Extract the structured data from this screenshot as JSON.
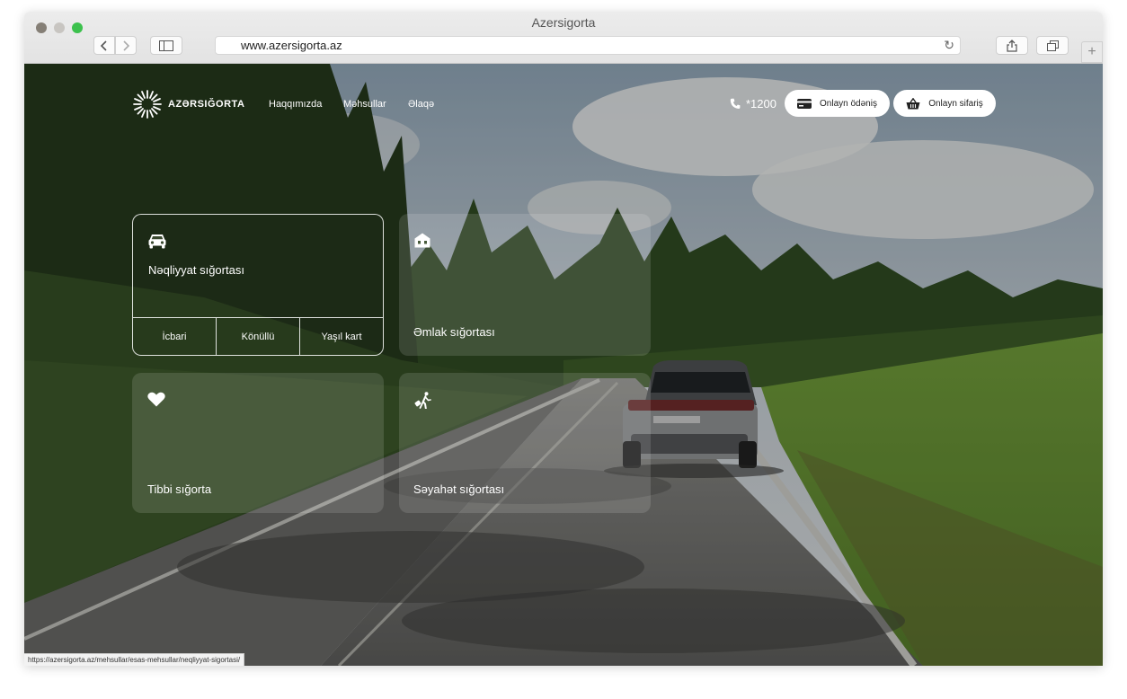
{
  "browser": {
    "window_title": "Azersigorta",
    "url": "www.azersigorta.az",
    "status_link": "https://azersigorta.az/mehsullar/esas-mehsullar/neqliyyat-sigortasi/"
  },
  "header": {
    "logo_text": "AZƏRSIĞORTA",
    "nav": {
      "about": "Haqqımızda",
      "products": "Məhsullar",
      "contact": "Əlaqə"
    },
    "phone": "*1200",
    "online_payment": "Onlayn ödəniş",
    "online_order": "Onlayn sifariş"
  },
  "cards": {
    "transport": {
      "title": "Nəqliyyat sığortası",
      "options": [
        "İcbari",
        "Könüllü",
        "Yaşıl kart"
      ]
    },
    "property": {
      "title": "Əmlak sığortası"
    },
    "medical": {
      "title": "Tibbi sığorta"
    },
    "travel": {
      "title": "Səyahət sığortası"
    }
  },
  "icons": {
    "transport": "car-icon",
    "property": "house-icon",
    "medical": "heart-icon",
    "travel": "traveler-icon",
    "phone": "phone-icon",
    "payment": "card-icon",
    "order": "basket-icon"
  },
  "colors": {
    "chrome_bg": "#e6e6e6",
    "pill_bg": "#ffffff",
    "card_text": "#ffffff"
  }
}
